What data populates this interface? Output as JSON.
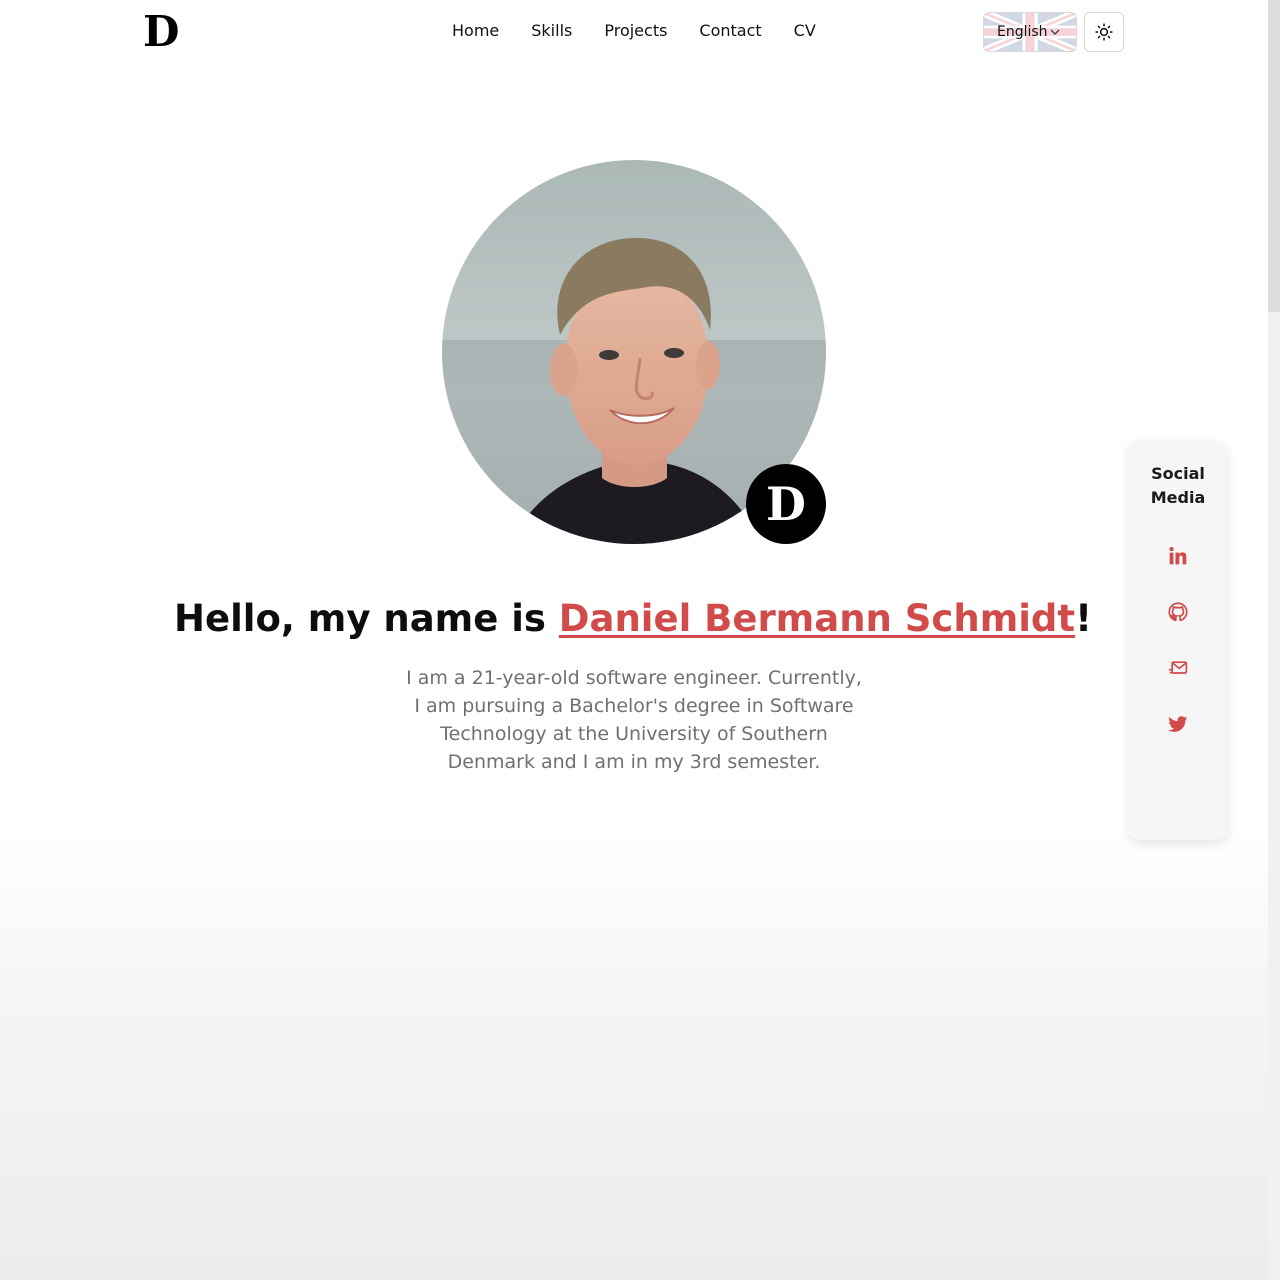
{
  "header": {
    "logo_text": "D",
    "nav": [
      {
        "label": "Home"
      },
      {
        "label": "Skills"
      },
      {
        "label": "Projects"
      },
      {
        "label": "Contact"
      },
      {
        "label": "CV"
      }
    ],
    "language": {
      "selected": "English",
      "flag_icon": "uk-flag-icon"
    },
    "theme_toggle_icon": "sun-icon"
  },
  "hero": {
    "badge_text": "D",
    "greeting": "Hello, my name is ",
    "name": "Daniel Bermann Schmidt",
    "exclaim": "!",
    "bio": "I am a 21-year-old software engineer. Currently, I am pursuing a Bachelor's degree in Software Technology at the University of Southern Denmark and I am in my 3rd semester."
  },
  "social": {
    "title_line1": "Social",
    "title_line2": "Media",
    "icons": [
      "linkedin-icon",
      "github-icon",
      "mail-icon",
      "twitter-icon"
    ]
  },
  "colors": {
    "accent": "#d14b4b",
    "text": "#0d0d0d",
    "muted": "#707070"
  }
}
